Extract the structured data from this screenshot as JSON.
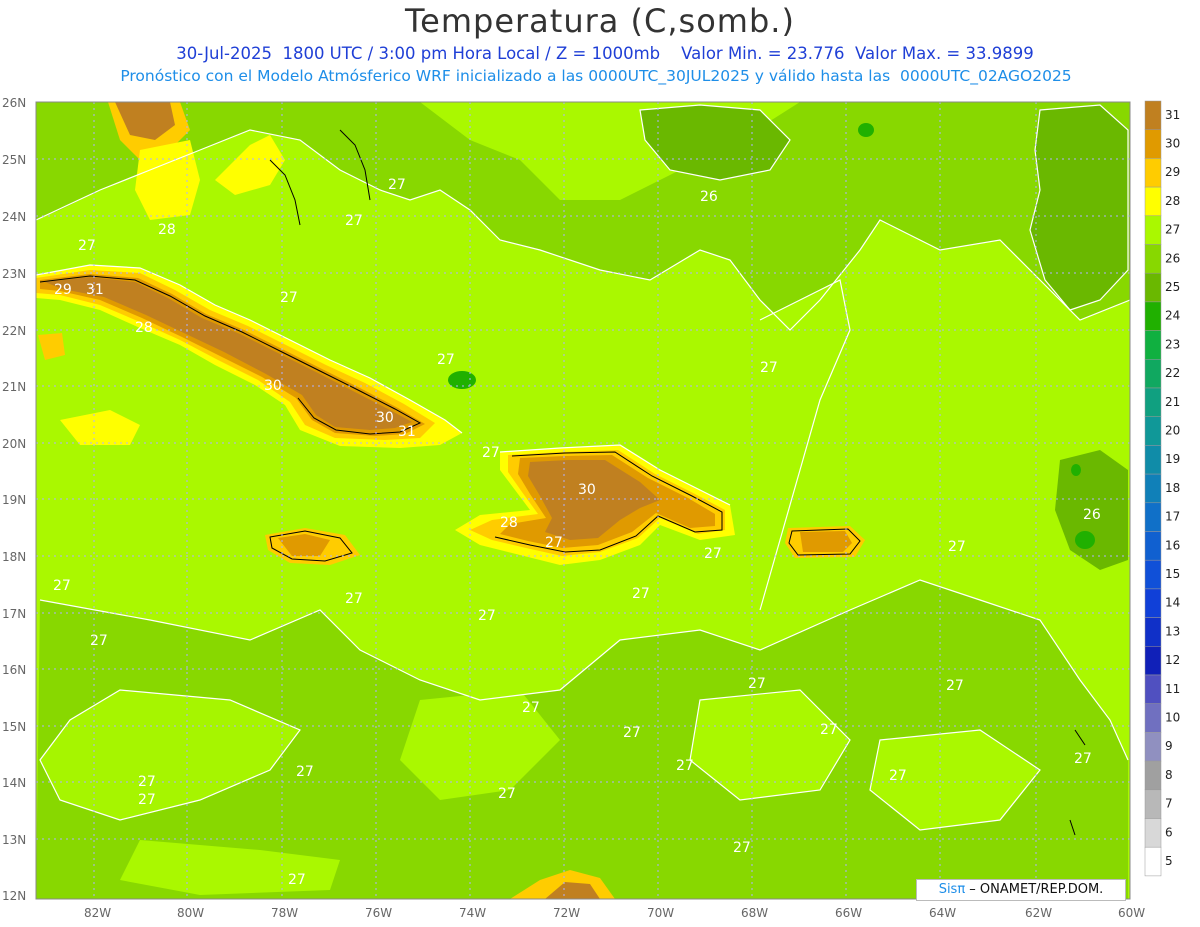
{
  "header": {
    "title": "Temperatura (C,somb.)",
    "info_line": "30-Jul-2025  1800 UTC / 3:00 pm Hora Local / Z = 1000mb    Valor Min. = 23.776  Valor Max. = 33.9899",
    "forecast_line": "Pronóstico con el Modelo Atmósferico WRF inicializado a las 0000UTC_30JUL2025 y válido hasta las  0000UTC_02AGO2025"
  },
  "map": {
    "lat_labels": [
      "26N",
      "25N",
      "24N",
      "23N",
      "22N",
      "21N",
      "20N",
      "19N",
      "18N",
      "17N",
      "16N",
      "15N",
      "14N",
      "13N",
      "12N"
    ],
    "lon_labels": [
      "82W",
      "80W",
      "78W",
      "76W",
      "74W",
      "72W",
      "70W",
      "68W",
      "66W",
      "64W",
      "62W",
      "60W"
    ],
    "contour_labels": [
      "27",
      "28",
      "29",
      "30",
      "31",
      "26"
    ],
    "colors": {
      "ocean_27": "#aaf800",
      "ocean_26": "#6ec800",
      "land_28": "#ffff00",
      "land_29": "#ffcc00",
      "land_30": "#e09a00",
      "land_31": "#c08020",
      "cool_25": "#4aa800",
      "grid": "#b0b0ff"
    }
  },
  "colorbar": {
    "levels": [
      "31",
      "30",
      "29",
      "28",
      "27",
      "26",
      "25",
      "24",
      "23",
      "22",
      "21",
      "20",
      "19",
      "18",
      "17",
      "16",
      "15",
      "14",
      "13",
      "12",
      "11",
      "10",
      "9",
      "8",
      "7",
      "6",
      "5"
    ],
    "colors": [
      "#c08020",
      "#e09a00",
      "#ffcc00",
      "#ffff00",
      "#aaf800",
      "#88d800",
      "#6ab800",
      "#20b000",
      "#10b040",
      "#10a860",
      "#10a080",
      "#109898",
      "#108ca8",
      "#1080b8",
      "#1070c8",
      "#1060d0",
      "#1050d8",
      "#1040d8",
      "#1030c8",
      "#1020b8",
      "#5050c0",
      "#7070c0",
      "#9090c0",
      "#a0a0a0",
      "#b8b8b8",
      "#d8d8d8",
      "#ffffff"
    ]
  },
  "credit": {
    "sis": "Sisπ",
    "text": " – ONAMET/REP.DOM."
  }
}
